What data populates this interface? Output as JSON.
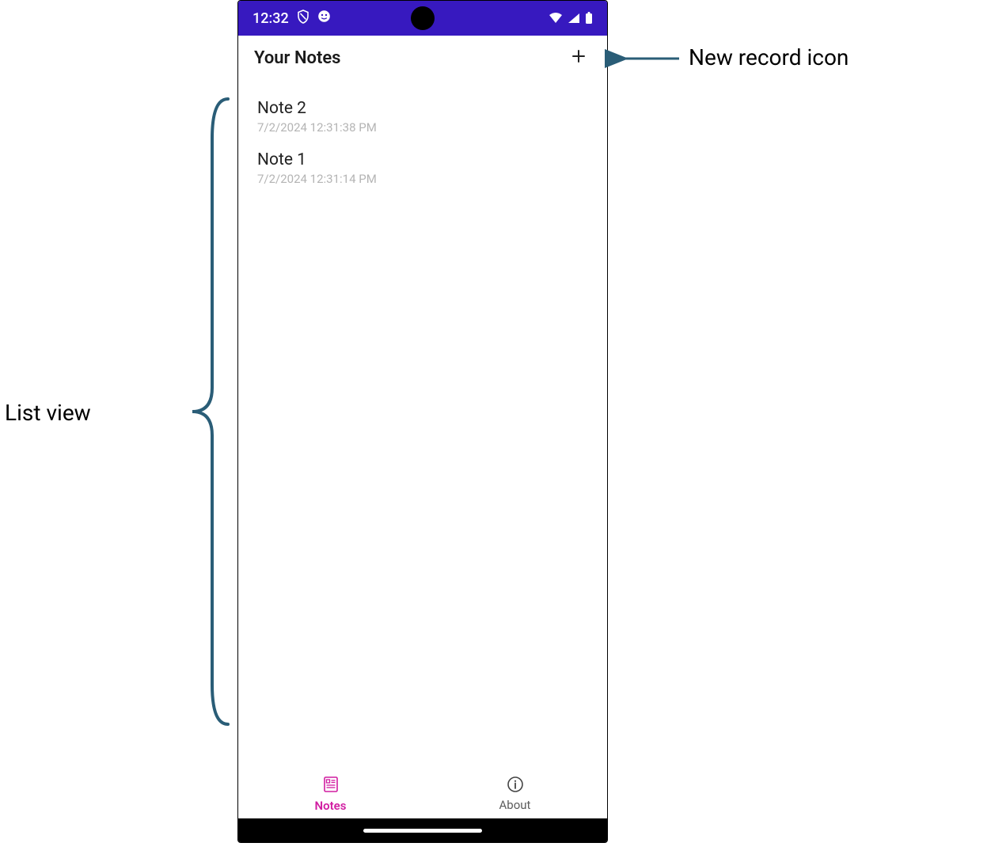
{
  "status_bar": {
    "time": "12:32"
  },
  "toolbar": {
    "title": "Your Notes"
  },
  "notes": [
    {
      "title": "Note 2",
      "timestamp": "7/2/2024 12:31:38 PM"
    },
    {
      "title": "Note 1",
      "timestamp": "7/2/2024 12:31:14 PM"
    }
  ],
  "tabs": {
    "notes_label": "Notes",
    "about_label": "About"
  },
  "annotations": {
    "new_record": "New record icon",
    "list_view": "List view"
  },
  "colors": {
    "status_bar_bg": "#3719bf",
    "accent": "#d11da1",
    "annotation_arrow": "#2a5d77"
  }
}
